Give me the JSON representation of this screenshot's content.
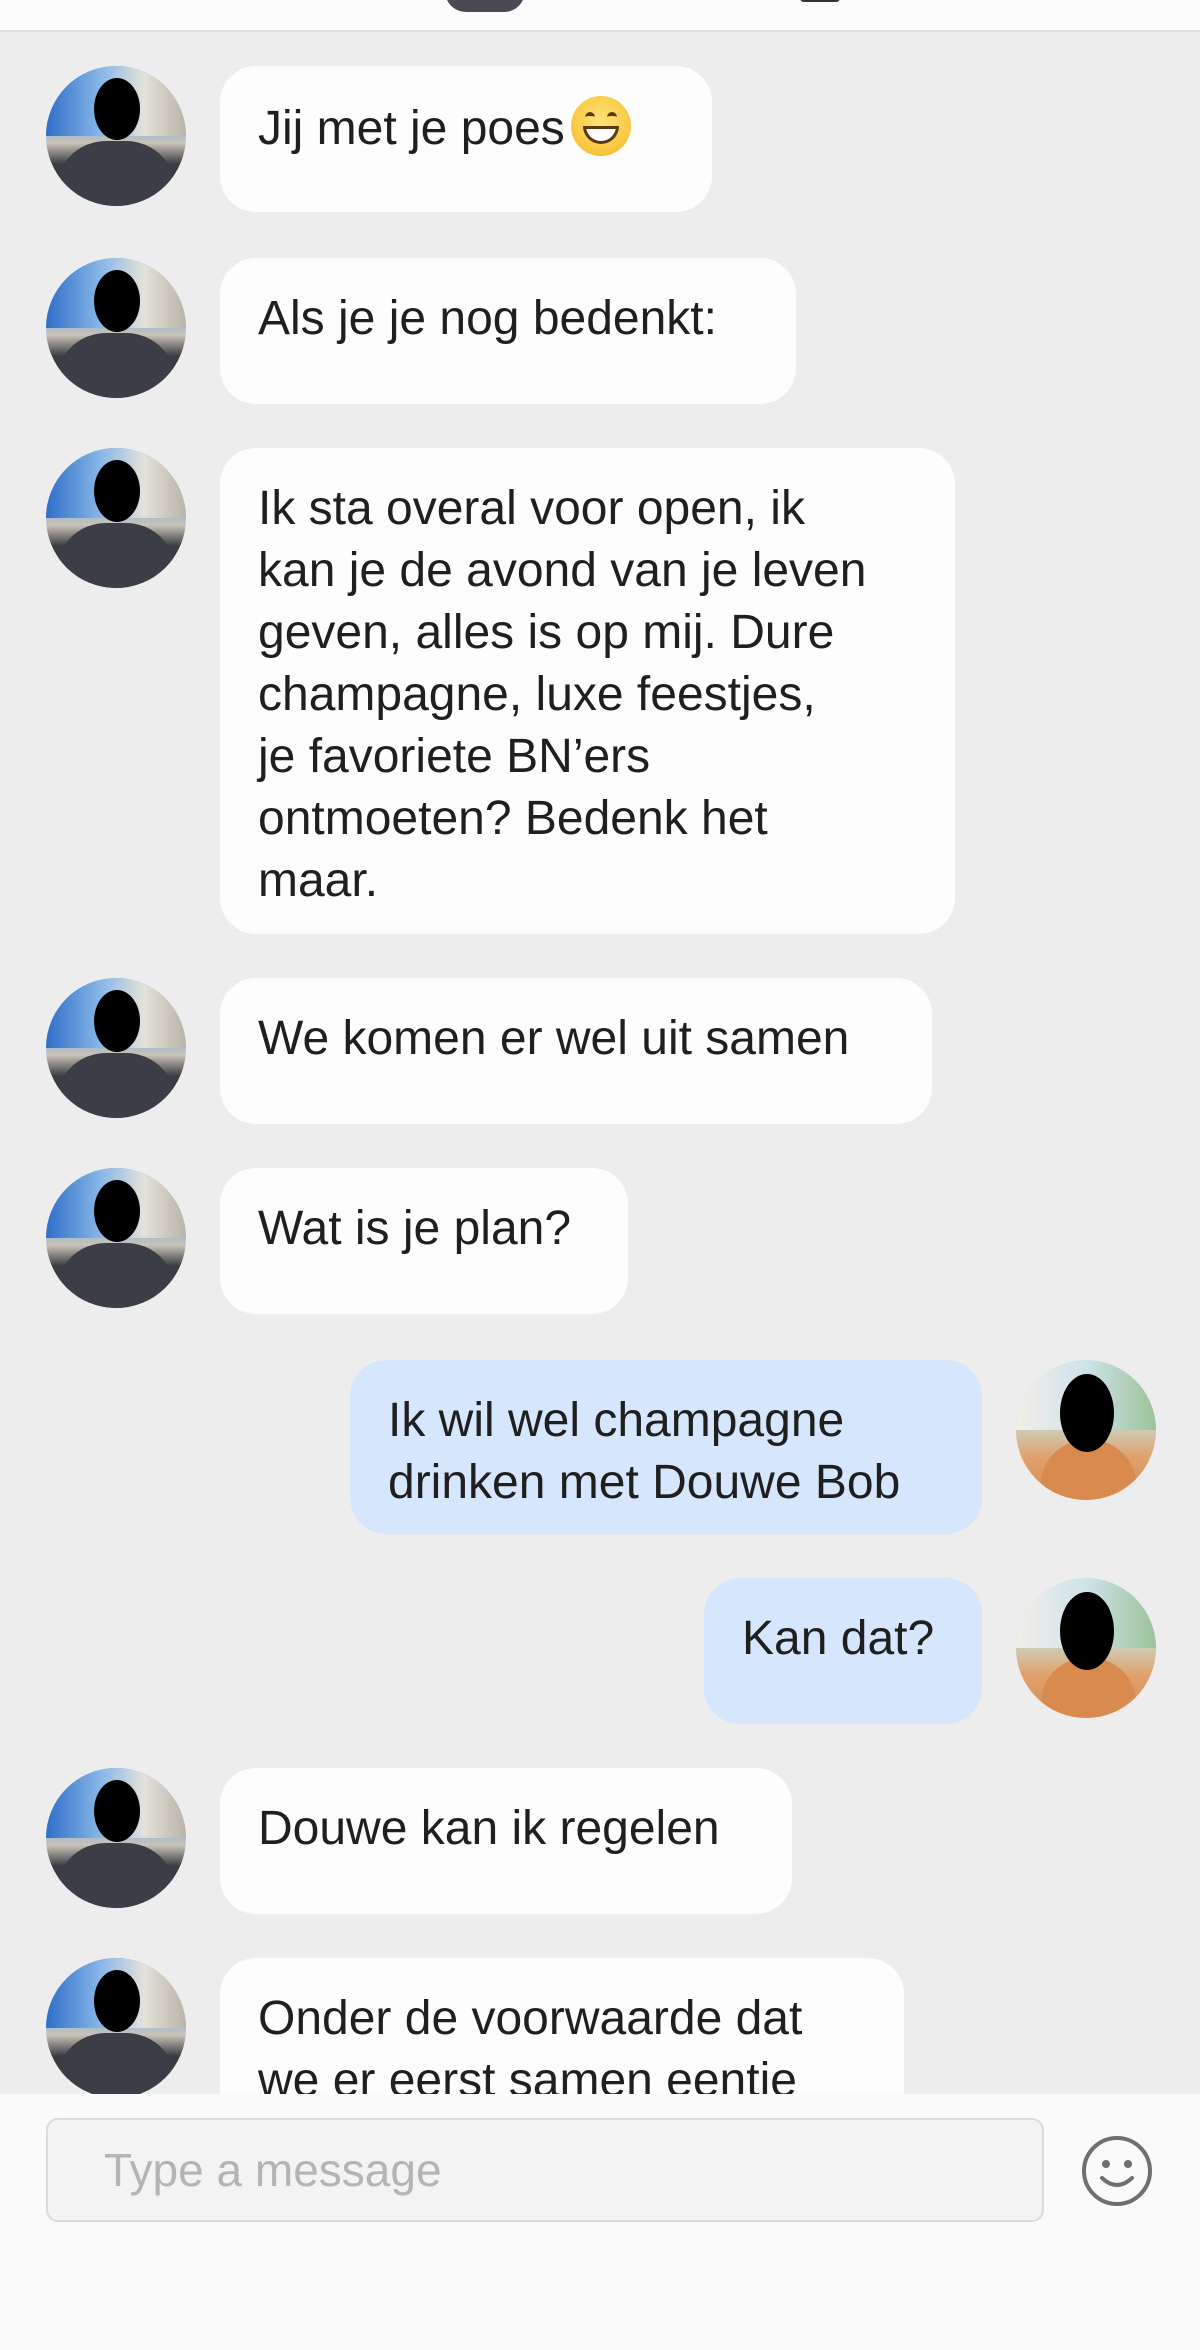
{
  "composer": {
    "placeholder": "Type a message"
  },
  "messages": [
    {
      "side": "in",
      "text": "Jij met je poes",
      "emoji": "grinning-face-emoji"
    },
    {
      "side": "in",
      "text": "Als je je nog bedenkt:"
    },
    {
      "side": "in",
      "text": "Ik sta overal voor open, ik\nkan je de avond van je leven\ngeven, alles is op mij. Dure\nchampagne, luxe feestjes,\nje favoriete BN’ers\nontmoeten? Bedenk het\nmaar."
    },
    {
      "side": "in",
      "text": "We komen er wel uit samen"
    },
    {
      "side": "in",
      "text": "Wat is je plan?"
    },
    {
      "side": "out",
      "text": "Ik wil wel champagne\ndrinken met Douwe Bob"
    },
    {
      "side": "out",
      "text": "Kan dat?"
    },
    {
      "side": "in",
      "text": "Douwe kan ik regelen"
    },
    {
      "side": "in",
      "text": "Onder de voorwaarde dat\nwe er eerst samen eentje"
    }
  ],
  "icons": {
    "emoji_button": "smiley-face-icon",
    "avatar_other": "contact-avatar",
    "avatar_me": "user-avatar"
  },
  "colors": {
    "background": "#ededed",
    "incoming_bubble": "#fdfdfd",
    "outgoing_bubble": "#d6e6fc",
    "composer": "#fafafa"
  }
}
